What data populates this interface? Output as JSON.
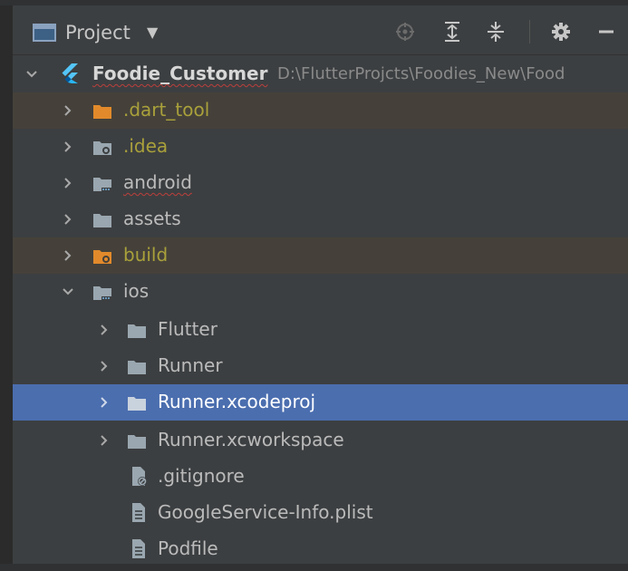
{
  "panel": {
    "title": "Project",
    "icons": {
      "window": "project-window-icon",
      "dropdown": "chevron-down-icon",
      "locate": "crosshair-icon",
      "expand_all": "expand-all-icon",
      "collapse_all": "collapse-all-icon",
      "settings": "gear-icon",
      "hide": "minimize-icon"
    }
  },
  "tree": {
    "root": {
      "name": "Foodie_Customer",
      "path": "D:\\FlutterProjcts\\Foodies_New\\Food"
    },
    "items": [
      {
        "label": ".dart_tool",
        "icon": "folder-orange-icon",
        "state": "collapsed"
      },
      {
        "label": ".idea",
        "icon": "folder-settings-icon",
        "state": "collapsed"
      },
      {
        "label": "android",
        "icon": "folder-module-icon",
        "state": "collapsed"
      },
      {
        "label": "assets",
        "icon": "folder-icon",
        "state": "collapsed"
      },
      {
        "label": "build",
        "icon": "folder-excluded-icon",
        "state": "collapsed"
      },
      {
        "label": "ios",
        "icon": "folder-module-icon",
        "state": "expanded"
      },
      {
        "label": "Flutter",
        "icon": "folder-icon",
        "state": "collapsed"
      },
      {
        "label": "Runner",
        "icon": "folder-icon",
        "state": "collapsed"
      },
      {
        "label": "Runner.xcodeproj",
        "icon": "folder-icon",
        "state": "collapsed"
      },
      {
        "label": "Runner.xcworkspace",
        "icon": "folder-icon",
        "state": "collapsed"
      },
      {
        "label": ".gitignore",
        "icon": "ignore-file-icon"
      },
      {
        "label": "GoogleService-Info.plist",
        "icon": "text-file-icon"
      },
      {
        "label": "Podfile",
        "icon": "text-file-icon"
      }
    ]
  },
  "colors": {
    "background": "#3c3f41",
    "selection": "#4b6eaf",
    "excluded_row": "#45413a",
    "excluded_text": "#a9a03b",
    "flutter_blue": "#54c5f8"
  }
}
